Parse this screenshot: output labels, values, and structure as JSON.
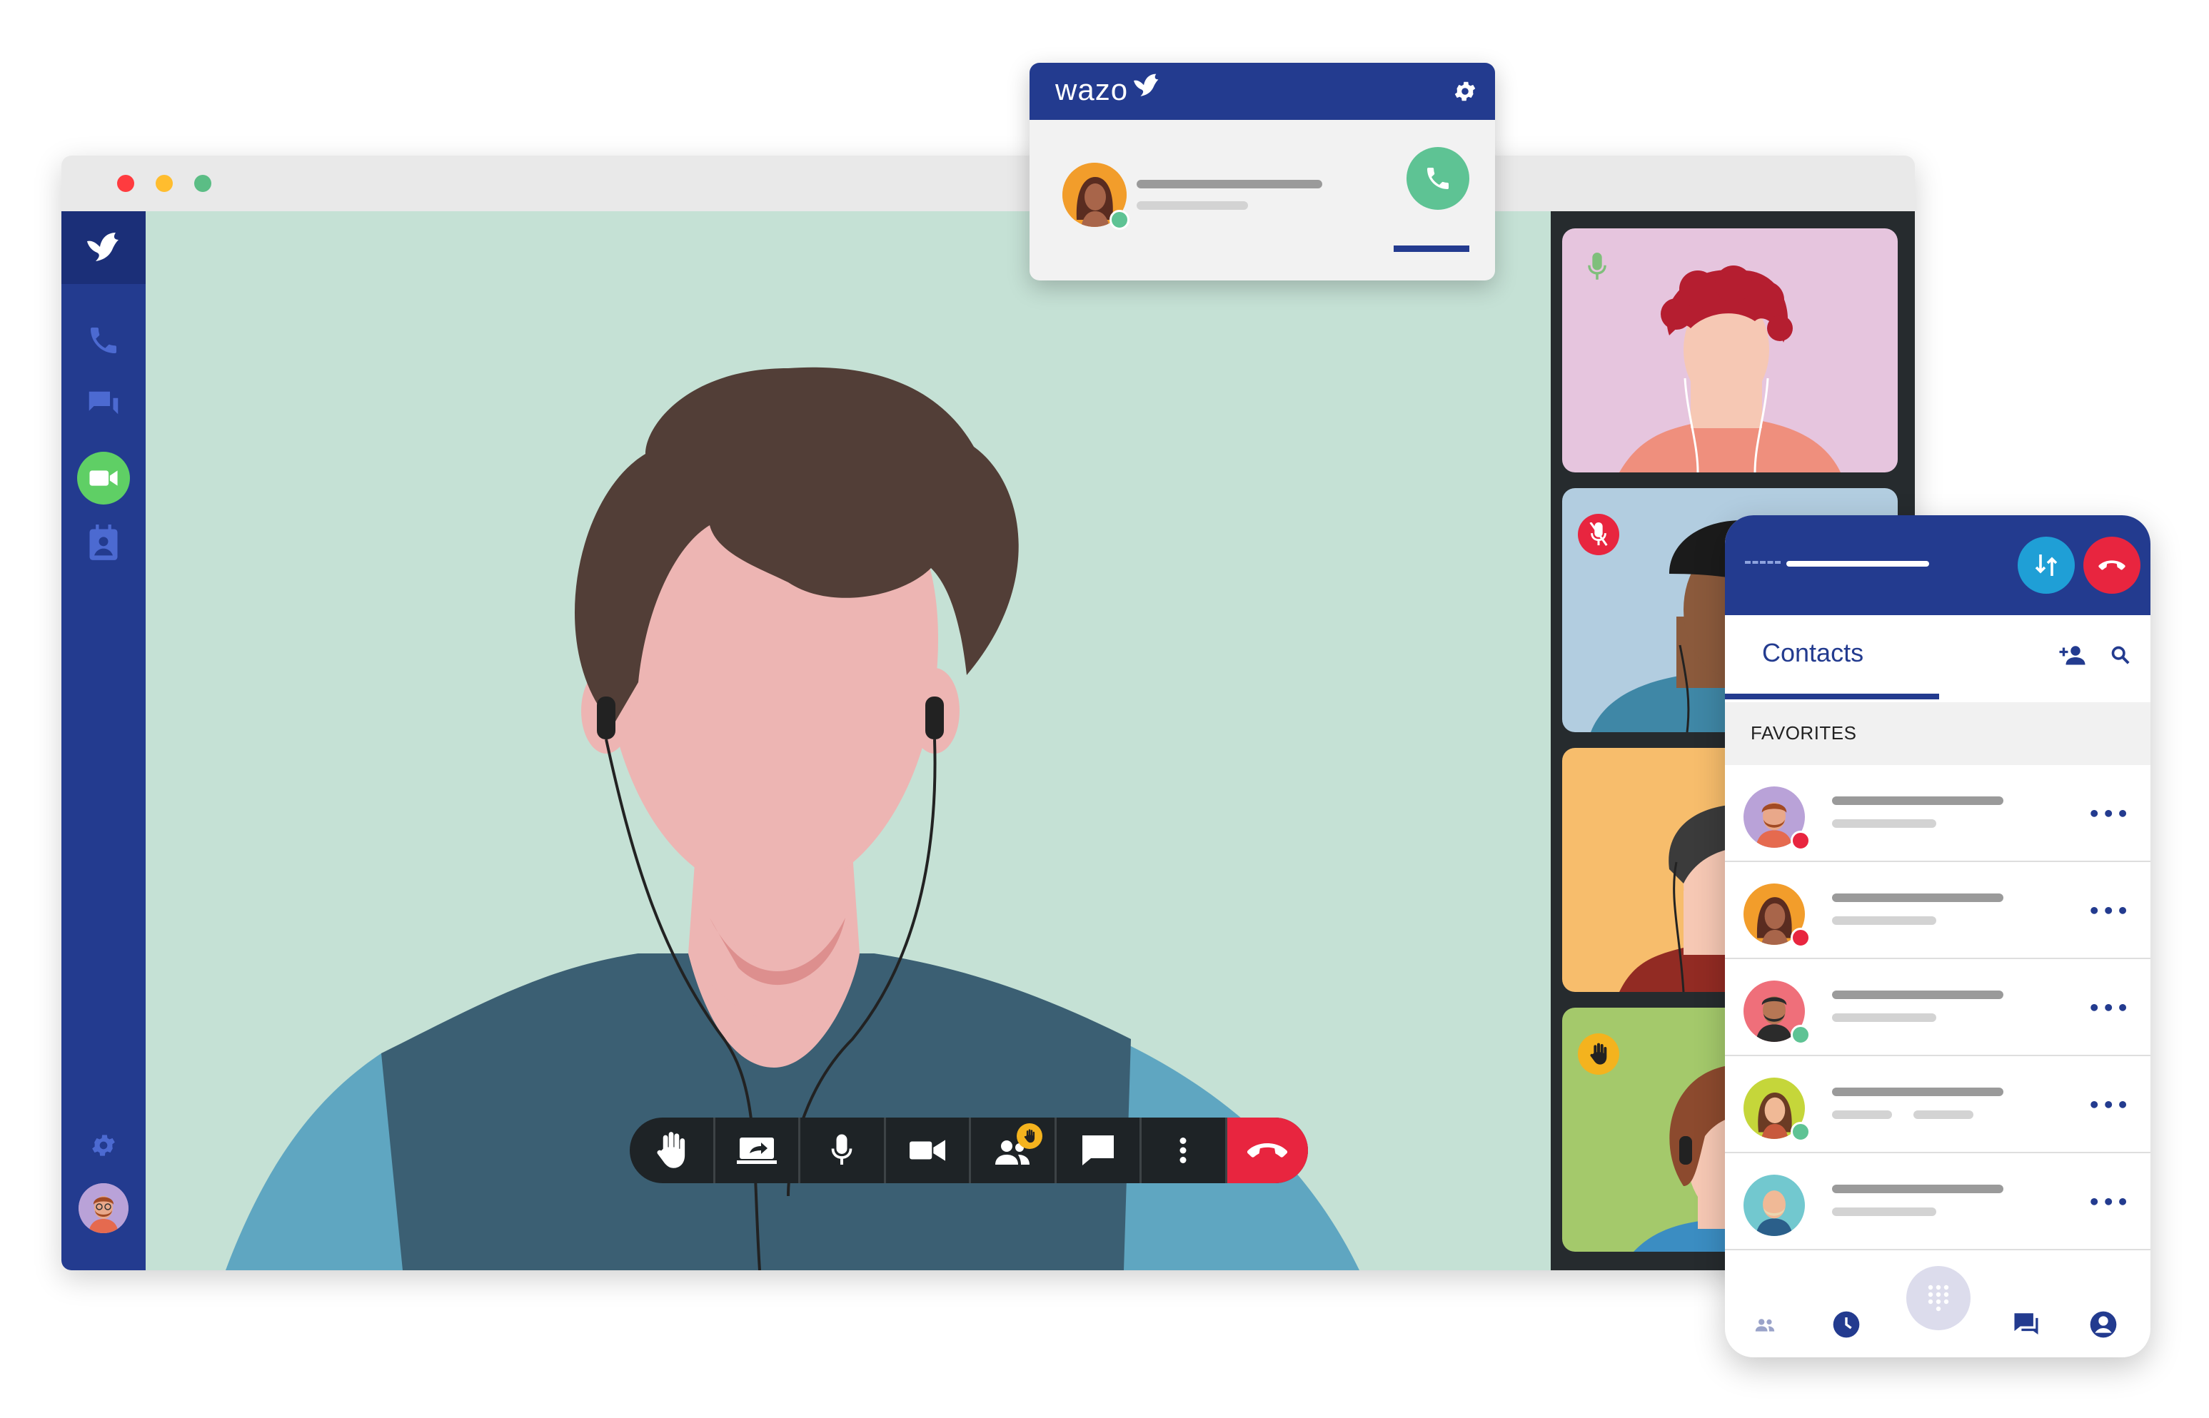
{
  "popup": {
    "brand": "wazo"
  },
  "phone": {
    "tab": "Contacts",
    "favorites_label": "FAVORITES",
    "row_more": "•••",
    "contacts_count": 5
  },
  "colors": {
    "brand_blue": "#233b8f",
    "video_green": "#5fcf65",
    "hangup_red": "#e8253f",
    "answer_green": "#5ec394",
    "transfer_blue": "#1f9fd6",
    "stage_bg": "#c5e1d5"
  },
  "icons": {
    "sidebar": [
      "bird-logo-icon",
      "phone-icon",
      "chat-icon",
      "video-camera-icon",
      "contact-card-icon",
      "gear-icon"
    ],
    "controls": [
      "raise-hand-icon",
      "share-screen-icon",
      "microphone-icon",
      "camera-icon",
      "participants-icon",
      "chat-icon",
      "more-vertical-icon",
      "hangup-icon"
    ],
    "phone_nav": [
      "people-icon",
      "clock-icon",
      "dialpad-icon",
      "chat-icon",
      "account-icon"
    ]
  }
}
